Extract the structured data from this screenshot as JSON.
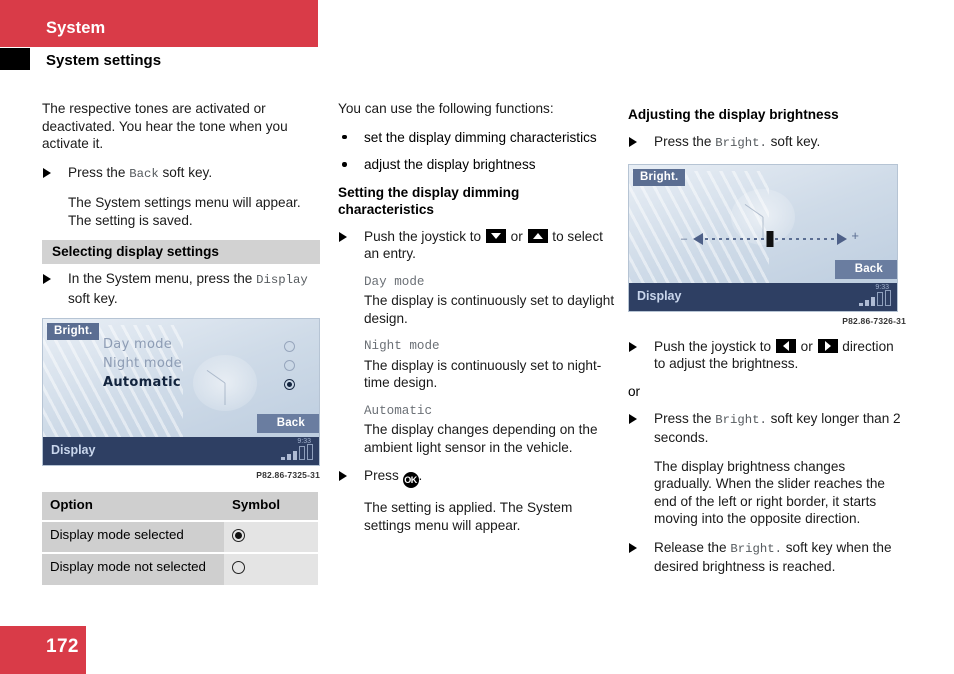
{
  "header": {
    "section_title": "System",
    "page_title": "System settings"
  },
  "page_number": "172",
  "left_column": {
    "intro_paragraph": "The respective tones are activated or deactivated. You hear the tone when you activate it.",
    "step_back": {
      "prefix": "Press the ",
      "key": "Back",
      "suffix": " soft key."
    },
    "back_result": "The System settings menu will appear. The setting is saved.",
    "section_bar": "Selecting display settings",
    "step_display": {
      "prefix": "In the System menu, press the ",
      "key": "Display",
      "suffix": " soft key."
    },
    "device_image": {
      "softkey_bright": "Bright.",
      "softkey_back": "Back",
      "status_label": "Display",
      "clock": "9:33",
      "menu": [
        {
          "label": "Day mode",
          "selected": false
        },
        {
          "label": "Night mode",
          "selected": false
        },
        {
          "label": "Automatic",
          "selected": true
        }
      ]
    },
    "figure_caption": "P82.86-7325-31",
    "table": {
      "headers": [
        "Option",
        "Symbol"
      ],
      "rows": [
        {
          "option": "Display mode selected",
          "symbol": "filled-radio-icon"
        },
        {
          "option": "Display mode not selected",
          "symbol": "empty-radio-icon"
        }
      ]
    }
  },
  "middle_column": {
    "functions_intro": "You can use the following functions:",
    "functions": [
      "set the display dimming characteristics",
      "adjust the display brightness"
    ],
    "subhead": "Setting the display dimming characteristics",
    "step_joystick": {
      "part1": "Push the joystick to ",
      "key1": "down-arrow-key",
      "part2": " or ",
      "key2": "up-arrow-key",
      "part3": " to select an entry."
    },
    "modes": [
      {
        "name": "Day mode",
        "description": "The display is continuously set to daylight design."
      },
      {
        "name": "Night mode",
        "description": "The display is continuously set to night-time design."
      },
      {
        "name": "Automatic",
        "description": "The display changes depending on the ambient light sensor in the vehicle."
      }
    ],
    "step_press_ok": {
      "prefix": "Press ",
      "key": "OK",
      "suffix": "."
    },
    "ok_result": "The setting is applied. The System settings menu will appear."
  },
  "right_column": {
    "subhead": "Adjusting the display brightness",
    "step_bright": {
      "prefix": "Press the ",
      "key": "Bright.",
      "suffix": " soft key."
    },
    "device_image": {
      "softkey_bright": "Bright.",
      "softkey_back": "Back",
      "status_label": "Display",
      "clock": "9:33",
      "slider": {
        "minus": "–",
        "plus": "+"
      }
    },
    "figure_caption": "P82.86-7326-31",
    "step_joystick": {
      "part1": "Push the joystick to ",
      "key1": "left-arrow-key",
      "part2": " or ",
      "key2": "right-arrow-key",
      "part3": " direction to adjust the brightness."
    },
    "or_label": "or",
    "step_long_press": {
      "prefix": "Press the ",
      "key": "Bright.",
      "suffix": " soft key longer than 2 seconds."
    },
    "long_press_result": "The display brightness changes gradually. When the slider reaches the end of the left or right border, it starts moving into the opposite direction.",
    "step_release": {
      "prefix": "Release the ",
      "key": "Bright.",
      "suffix": " soft key when the desired brightness is reached."
    }
  },
  "colors": {
    "brand_red": "#d93b48",
    "grey_bar": "#d2d2d2",
    "table_cell_dark": "#cfcfcf",
    "table_cell_light": "#e4e4e4"
  }
}
